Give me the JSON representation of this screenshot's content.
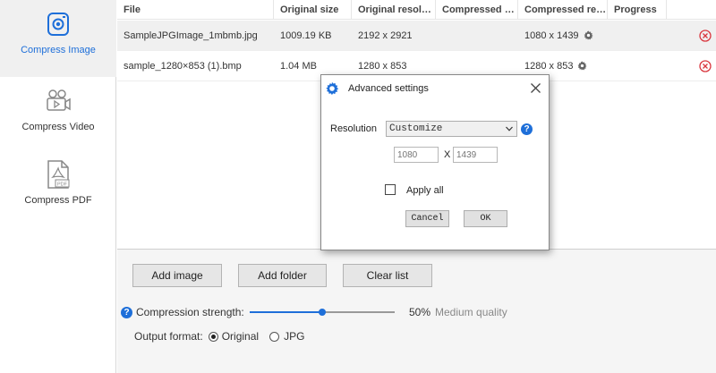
{
  "sidebar": {
    "items": [
      {
        "label": "Compress Image",
        "icon": "camera-icon",
        "active": true
      },
      {
        "label": "Compress Video",
        "icon": "video-camera-icon",
        "active": false
      },
      {
        "label": "Compress PDF",
        "icon": "pdf-file-icon",
        "active": false
      }
    ]
  },
  "table": {
    "columns": [
      "File",
      "Original size",
      "Original resolution",
      "Compressed s...",
      "Compressed reso...",
      "Progress"
    ],
    "rows": [
      {
        "file": "SampleJPGImage_1mbmb.jpg",
        "original_size": "1009.19 KB",
        "original_resolution": "2192 x 2921",
        "compressed_size": "",
        "compressed_resolution": "1080 x 1439",
        "progress": ""
      },
      {
        "file": "sample_1280×853 (1).bmp",
        "original_size": "1.04 MB",
        "original_resolution": "1280 x 853",
        "compressed_size": "",
        "compressed_resolution": "1280 x 853",
        "progress": ""
      }
    ]
  },
  "buttons": {
    "add_image": "Add image",
    "add_folder": "Add folder",
    "clear_list": "Clear list"
  },
  "compression": {
    "label": "Compression strength:",
    "value_percent": 50,
    "value_text": "50%",
    "quality": "Medium quality"
  },
  "output_format": {
    "label": "Output format:",
    "options": [
      "Original",
      "JPG"
    ],
    "selected": "Original"
  },
  "dialog": {
    "title": "Advanced settings",
    "resolution_label": "Resolution",
    "resolution_value": "Customize",
    "width_placeholder": "1080",
    "height_placeholder": "1439",
    "x_separator": "X",
    "apply_all_label": "Apply all",
    "apply_all_checked": false,
    "cancel_label": "Cancel",
    "ok_label": "OK"
  },
  "colors": {
    "accent": "#1e6fd9",
    "delete": "#d9363e"
  }
}
